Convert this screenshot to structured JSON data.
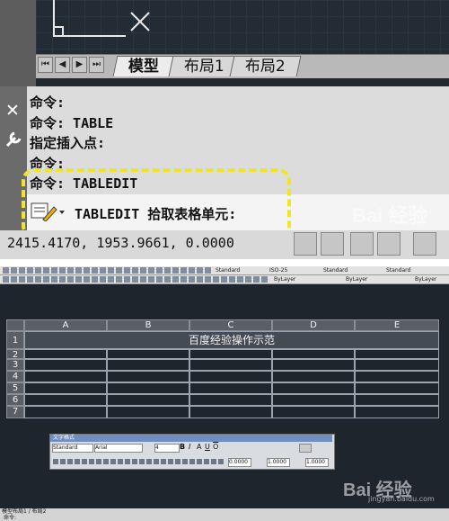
{
  "top": {
    "layout_tabs": [
      "模型",
      "布局1",
      "布局2"
    ],
    "command_history": [
      "命令:",
      "命令: TABLE",
      "指定插入点:",
      "命令:",
      "命令: TABLEDIT"
    ],
    "command_prompt": "TABLEDIT 拾取表格单元:",
    "coordinates": "2415.4170, 1953.9661, 0.0000",
    "highlight_color": "#f2e42a",
    "watermark": "Bai 经验"
  },
  "bottom": {
    "style1": "Standard",
    "style2": "ISO-25",
    "style3": "Standard",
    "style4": "Standard",
    "layer1": "ByLayer",
    "layer2": "ByLayer",
    "layer3": "ByLayer",
    "model_tab": "模型",
    "layout_tab": "布局1 / 布局2",
    "cmd_line": "命令: ",
    "table": {
      "col_headers": [
        "A",
        "B",
        "C",
        "D",
        "E"
      ],
      "row_headers": [
        "1",
        "2",
        "3",
        "4",
        "5",
        "6",
        "7"
      ],
      "title": "百度经验操作示范"
    },
    "text_format": {
      "title": "文字格式",
      "style": "Standard",
      "font": "Arial",
      "height": "4",
      "val1": "0.0000",
      "val2": "1.0000",
      "val3": "1.0000"
    },
    "watermark": "Bai 经验",
    "watermark_url": "jingyan.baidu.com"
  }
}
